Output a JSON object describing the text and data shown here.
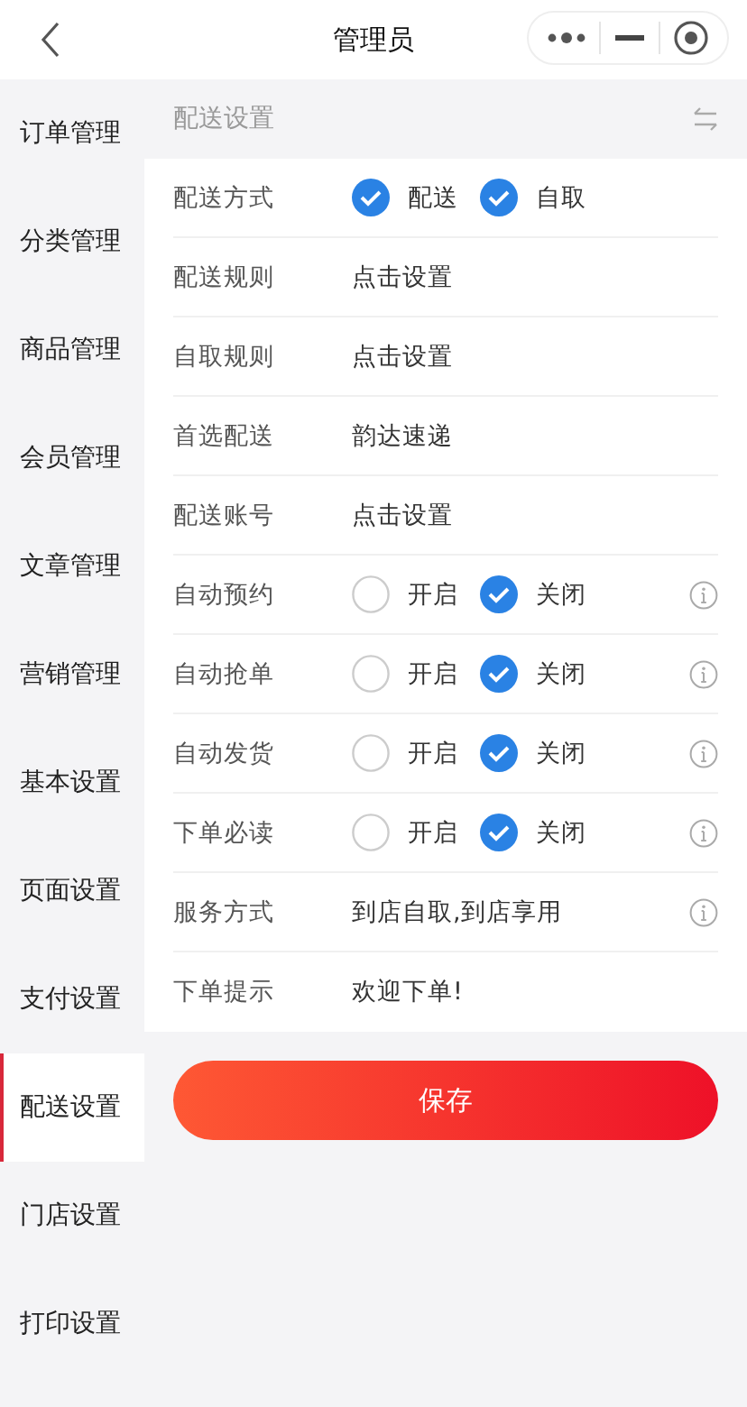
{
  "title": "管理员",
  "sidebar": {
    "items": [
      {
        "label": "订单管理",
        "selected": false
      },
      {
        "label": "分类管理",
        "selected": false
      },
      {
        "label": "商品管理",
        "selected": false
      },
      {
        "label": "会员管理",
        "selected": false
      },
      {
        "label": "文章管理",
        "selected": false
      },
      {
        "label": "营销管理",
        "selected": false
      },
      {
        "label": "基本设置",
        "selected": false
      },
      {
        "label": "页面设置",
        "selected": false
      },
      {
        "label": "支付设置",
        "selected": false
      },
      {
        "label": "配送设置",
        "selected": true
      },
      {
        "label": "门店设置",
        "selected": false
      },
      {
        "label": "打印设置",
        "selected": false
      }
    ]
  },
  "section_title": "配送设置",
  "rows": [
    {
      "kind": "checks",
      "label": "配送方式",
      "options": [
        {
          "label": "配送",
          "checked": true
        },
        {
          "label": "自取",
          "checked": true
        }
      ],
      "info": false
    },
    {
      "kind": "text",
      "label": "配送规则",
      "value": "点击设置",
      "info": false
    },
    {
      "kind": "text",
      "label": "自取规则",
      "value": "点击设置",
      "info": false
    },
    {
      "kind": "text",
      "label": "首选配送",
      "value": "韵达速递",
      "info": false
    },
    {
      "kind": "text",
      "label": "配送账号",
      "value": "点击设置",
      "info": false
    },
    {
      "kind": "radio",
      "label": "自动预约",
      "options": [
        {
          "label": "开启",
          "selected": false
        },
        {
          "label": "关闭",
          "selected": true
        }
      ],
      "info": true
    },
    {
      "kind": "radio",
      "label": "自动抢单",
      "options": [
        {
          "label": "开启",
          "selected": false
        },
        {
          "label": "关闭",
          "selected": true
        }
      ],
      "info": true
    },
    {
      "kind": "radio",
      "label": "自动发货",
      "options": [
        {
          "label": "开启",
          "selected": false
        },
        {
          "label": "关闭",
          "selected": true
        }
      ],
      "info": true
    },
    {
      "kind": "radio",
      "label": "下单必读",
      "options": [
        {
          "label": "开启",
          "selected": false
        },
        {
          "label": "关闭",
          "selected": true
        }
      ],
      "info": true
    },
    {
      "kind": "text",
      "label": "服务方式",
      "value": "到店自取,到店享用",
      "info": true
    },
    {
      "kind": "text",
      "label": "下单提示",
      "value": "欢迎下单!",
      "info": false
    }
  ],
  "save_button": "保存"
}
